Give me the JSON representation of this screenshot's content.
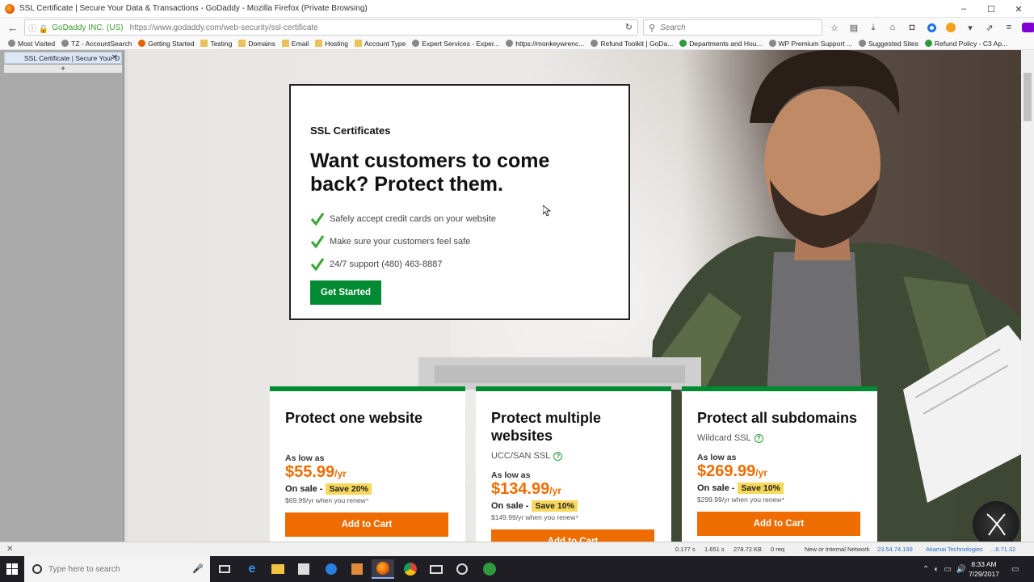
{
  "window": {
    "title": "SSL Certificate | Secure Your Data & Transactions - GoDaddy - Mozilla Firefox (Private Browsing)",
    "minimize": "–",
    "maximize": "☐",
    "close": "✕"
  },
  "navbar": {
    "back": "←",
    "identity": "GoDaddy INC. (US)",
    "url": "https://www.godaddy.com/web-security/ssl-certificate",
    "reload": "↻",
    "search_placeholder": "Search"
  },
  "bookmarks": [
    {
      "label": "Most Visited",
      "icon": "globe"
    },
    {
      "label": "TZ - AccountSearch",
      "icon": "globe"
    },
    {
      "label": "Getting Started",
      "icon": "ff"
    },
    {
      "label": "Testing",
      "icon": "folder"
    },
    {
      "label": "Domains",
      "icon": "folder"
    },
    {
      "label": "Email",
      "icon": "folder"
    },
    {
      "label": "Hosting",
      "icon": "folder"
    },
    {
      "label": "Account Type",
      "icon": "folder"
    },
    {
      "label": "Expert Services - Exper...",
      "icon": "globe"
    },
    {
      "label": "https://monkeywrenc...",
      "icon": "globe"
    },
    {
      "label": "Refund Toolkit | GoDa...",
      "icon": "globe"
    },
    {
      "label": "Departments and Hou...",
      "icon": "green"
    },
    {
      "label": "WP Premium Support ...",
      "icon": "globe"
    },
    {
      "label": "Suggested Sites",
      "icon": "globe"
    },
    {
      "label": "Refund Policy - C3 Ap...",
      "icon": "green"
    }
  ],
  "sidebar": {
    "tab_label": "SSL Certificate | Secure Your D",
    "new_tab": "+"
  },
  "hero": {
    "eyebrow": "SSL Certificates",
    "headline": "Want customers to come back? Protect them.",
    "bullets": [
      "Safely accept credit cards on your website",
      "Make sure your customers feel safe",
      "24/7 support (480) 463-8887"
    ],
    "cta": "Get Started"
  },
  "plans": [
    {
      "title": "Protect one website",
      "subtitle": "",
      "as_low_as": "As low as",
      "price": "$55.99",
      "per": "/yr",
      "on_sale": "On sale -",
      "save": "Save 20%",
      "renew": "$69.99/yr when you renew⁴",
      "cta": "Add to Cart"
    },
    {
      "title": "Protect multiple websites",
      "subtitle": "UCC/SAN SSL",
      "as_low_as": "As low as",
      "price": "$134.99",
      "per": "/yr",
      "on_sale": "On sale -",
      "save": "Save 10%",
      "renew": "$149.99/yr when you renew⁴",
      "cta": "Add to Cart"
    },
    {
      "title": "Protect all subdomains",
      "subtitle": "Wildcard SSL",
      "as_low_as": "As low as",
      "price": "$269.99",
      "per": "/yr",
      "on_sale": "On sale -",
      "save": "Save 10%",
      "renew": "$299.99/yr when you renew⁴",
      "cta": "Add to Cart"
    }
  ],
  "statusbar": {
    "t1": "0.177 s",
    "t2": "1.651 s",
    "size": "278.72 KB",
    "req": "0 req",
    "network": "New or Internal Network",
    "ip": "23.54.74.199",
    "cdn": "Akamai Technologies",
    "ip2": "...8.71.32"
  },
  "taskbar": {
    "search_placeholder": "Type here to search",
    "time": "8:33 AM",
    "date": "7/29/2017"
  },
  "colors": {
    "green": "#008a32",
    "orange": "#ef6c00",
    "highlight": "#f7d85b"
  }
}
